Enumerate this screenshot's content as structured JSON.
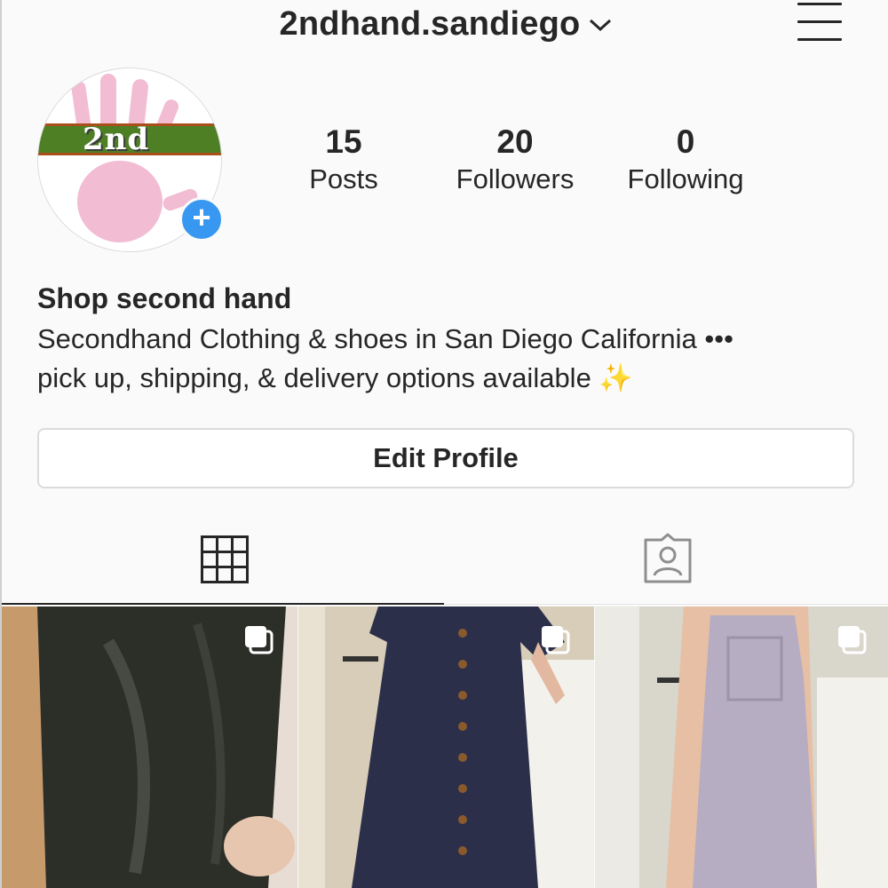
{
  "header": {
    "username": "2ndhand.sandiego"
  },
  "profile": {
    "avatar_text": "2nd",
    "stats": [
      {
        "value": "15",
        "label": "Posts"
      },
      {
        "value": "20",
        "label": "Followers"
      },
      {
        "value": "0",
        "label": "Following"
      }
    ],
    "name": "Shop second hand",
    "bio_line1": "Secondhand Clothing & shoes in San Diego California •••",
    "bio_line2": "pick up, shipping, & delivery options available ✨",
    "edit_profile_label": "Edit Profile"
  },
  "tabs": [
    {
      "icon": "grid-icon",
      "active": true
    },
    {
      "icon": "tagged-person-icon",
      "active": false
    }
  ],
  "posts": [
    {
      "description": "black satin dress",
      "multi": true
    },
    {
      "description": "navy pinstripe button dress",
      "multi": true
    },
    {
      "description": "lavender overall dress",
      "multi": true
    }
  ],
  "colors": {
    "accent_blue": "#3897f0",
    "text": "#262626",
    "logo_green": "#4e7f25"
  }
}
